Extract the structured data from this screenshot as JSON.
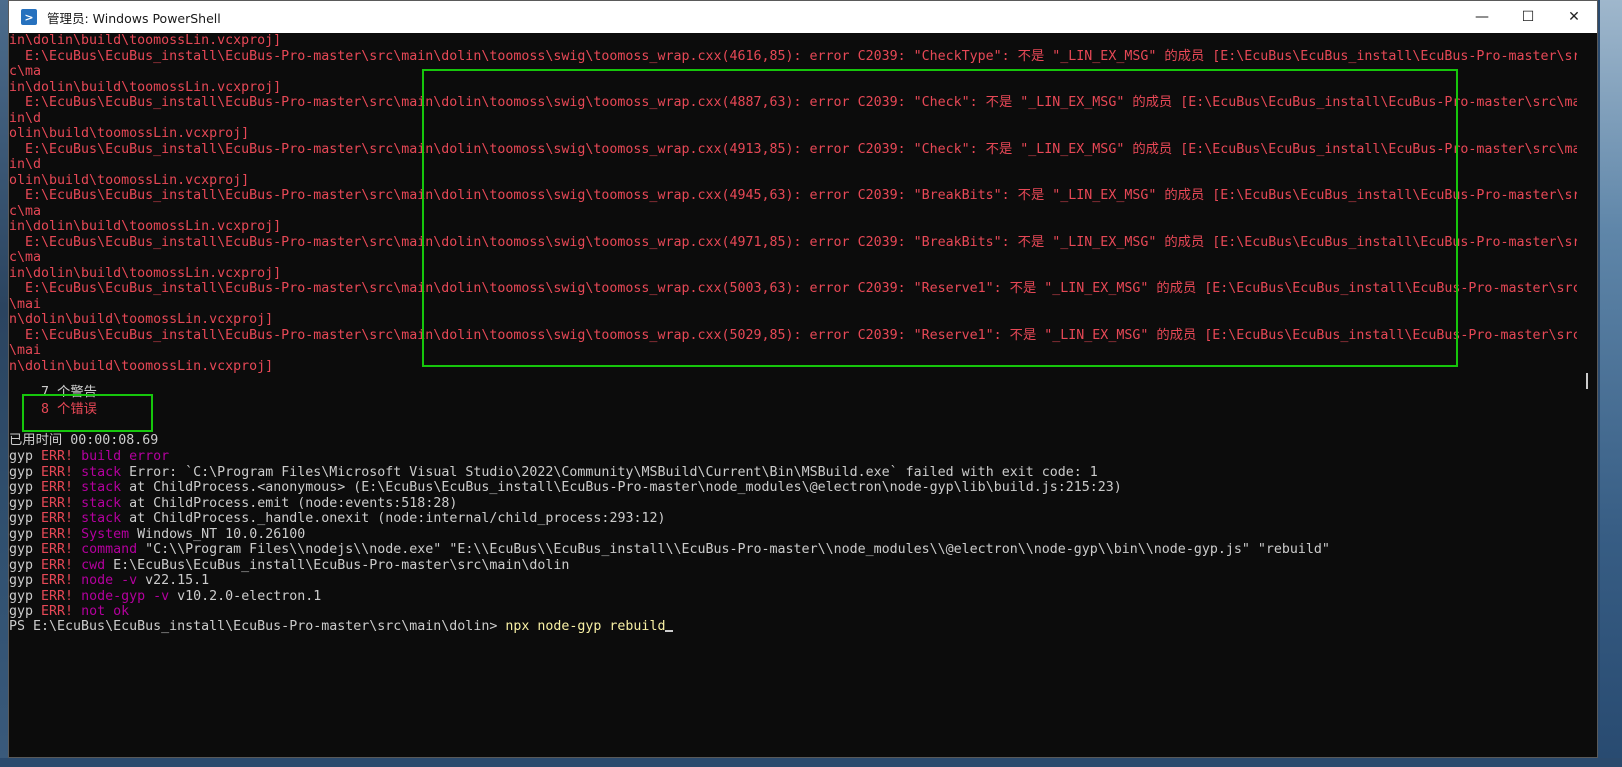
{
  "window": {
    "title": "管理员: Windows PowerShell",
    "icon": "powershell-icon",
    "controls": {
      "minimize": "—",
      "maximize": "☐",
      "close": "✕"
    }
  },
  "console": {
    "error_lines": [
      "in\\dolin\\build\\toomossLin.vcxproj]",
      "  E:\\EcuBus\\EcuBus_install\\EcuBus-Pro-master\\src\\main\\dolin\\toomoss\\swig\\toomoss_wrap.cxx(4616,85): error C2039: \"CheckType\": 不是 \"_LIN_EX_MSG\" 的成员 [E:\\EcuBus\\EcuBus_install\\EcuBus-Pro-master\\sr",
      "c\\ma",
      "in\\dolin\\build\\toomossLin.vcxproj]",
      "  E:\\EcuBus\\EcuBus_install\\EcuBus-Pro-master\\src\\main\\dolin\\toomoss\\swig\\toomoss_wrap.cxx(4887,63): error C2039: \"Check\": 不是 \"_LIN_EX_MSG\" 的成员 [E:\\EcuBus\\EcuBus_install\\EcuBus-Pro-master\\src\\ma",
      "in\\d",
      "olin\\build\\toomossLin.vcxproj]",
      "  E:\\EcuBus\\EcuBus_install\\EcuBus-Pro-master\\src\\main\\dolin\\toomoss\\swig\\toomoss_wrap.cxx(4913,85): error C2039: \"Check\": 不是 \"_LIN_EX_MSG\" 的成员 [E:\\EcuBus\\EcuBus_install\\EcuBus-Pro-master\\src\\ma",
      "in\\d",
      "olin\\build\\toomossLin.vcxproj]",
      "  E:\\EcuBus\\EcuBus_install\\EcuBus-Pro-master\\src\\main\\dolin\\toomoss\\swig\\toomoss_wrap.cxx(4945,63): error C2039: \"BreakBits\": 不是 \"_LIN_EX_MSG\" 的成员 [E:\\EcuBus\\EcuBus_install\\EcuBus-Pro-master\\sr",
      "c\\ma",
      "in\\dolin\\build\\toomossLin.vcxproj]",
      "  E:\\EcuBus\\EcuBus_install\\EcuBus-Pro-master\\src\\main\\dolin\\toomoss\\swig\\toomoss_wrap.cxx(4971,85): error C2039: \"BreakBits\": 不是 \"_LIN_EX_MSG\" 的成员 [E:\\EcuBus\\EcuBus_install\\EcuBus-Pro-master\\sr",
      "c\\ma",
      "in\\dolin\\build\\toomossLin.vcxproj]",
      "  E:\\EcuBus\\EcuBus_install\\EcuBus-Pro-master\\src\\main\\dolin\\toomoss\\swig\\toomoss_wrap.cxx(5003,63): error C2039: \"Reserve1\": 不是 \"_LIN_EX_MSG\" 的成员 [E:\\EcuBus\\EcuBus_install\\EcuBus-Pro-master\\src",
      "\\mai",
      "n\\dolin\\build\\toomossLin.vcxproj]",
      "  E:\\EcuBus\\EcuBus_install\\EcuBus-Pro-master\\src\\main\\dolin\\toomoss\\swig\\toomoss_wrap.cxx(5029,85): error C2039: \"Reserve1\": 不是 \"_LIN_EX_MSG\" 的成员 [E:\\EcuBus\\EcuBus_install\\EcuBus-Pro-master\\src",
      "\\mai",
      "n\\dolin\\build\\toomossLin.vcxproj]"
    ],
    "warnings_summary": "    7 个警告",
    "errors_summary": "    8 个错误",
    "elapsed": "已用时间 00:00:08.69",
    "gyp_lines": [
      {
        "prefix": "gyp ",
        "tag": "ERR!",
        "key": " build error",
        "rest": ""
      },
      {
        "prefix": "gyp ",
        "tag": "ERR!",
        "key": " stack",
        "rest": " Error: `C:\\Program Files\\Microsoft Visual Studio\\2022\\Community\\MSBuild\\Current\\Bin\\MSBuild.exe` failed with exit code: 1"
      },
      {
        "prefix": "gyp ",
        "tag": "ERR!",
        "key": " stack",
        "rest": " at ChildProcess.<anonymous> (E:\\EcuBus\\EcuBus_install\\EcuBus-Pro-master\\node_modules\\@electron\\node-gyp\\lib\\build.js:215:23)"
      },
      {
        "prefix": "gyp ",
        "tag": "ERR!",
        "key": " stack",
        "rest": " at ChildProcess.emit (node:events:518:28)"
      },
      {
        "prefix": "gyp ",
        "tag": "ERR!",
        "key": " stack",
        "rest": " at ChildProcess._handle.onexit (node:internal/child_process:293:12)"
      },
      {
        "prefix": "gyp ",
        "tag": "ERR!",
        "key": " System",
        "rest": " Windows_NT 10.0.26100"
      },
      {
        "prefix": "gyp ",
        "tag": "ERR!",
        "key": " command",
        "rest": " \"C:\\\\Program Files\\\\nodejs\\\\node.exe\" \"E:\\\\EcuBus\\\\EcuBus_install\\\\EcuBus-Pro-master\\\\node_modules\\\\@electron\\\\node-gyp\\\\bin\\\\node-gyp.js\" \"rebuild\""
      },
      {
        "prefix": "gyp ",
        "tag": "ERR!",
        "key": " cwd",
        "rest": " E:\\EcuBus\\EcuBus_install\\EcuBus-Pro-master\\src\\main\\dolin"
      },
      {
        "prefix": "gyp ",
        "tag": "ERR!",
        "key": " node -v",
        "rest": " v22.15.1"
      },
      {
        "prefix": "gyp ",
        "tag": "ERR!",
        "key": " node-gyp -v",
        "rest": " v10.2.0-electron.1"
      },
      {
        "prefix": "gyp ",
        "tag": "ERR!",
        "key": " not ok",
        "rest": ""
      }
    ],
    "prompt": "PS E:\\EcuBus\\EcuBus_install\\EcuBus-Pro-master\\src\\main\\dolin> ",
    "command": "npx node-gyp rebuild"
  },
  "colors": {
    "error_red": "#e74856",
    "highlight_green": "#16c60c",
    "terminal_bg": "#0c0c0c",
    "prompt_yellow": "#f9f1a5"
  }
}
